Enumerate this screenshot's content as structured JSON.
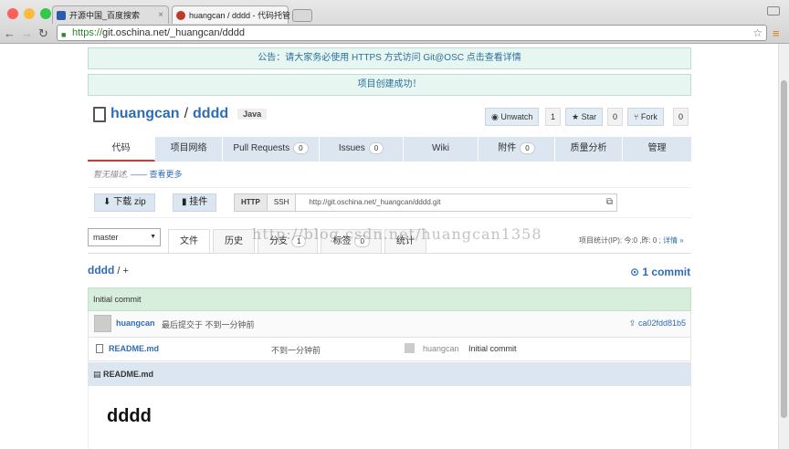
{
  "browser": {
    "tabs": [
      {
        "title": "开源中国_百度搜索",
        "close": "×"
      },
      {
        "title": "huangcan / dddd - 代码托管",
        "close": "×"
      }
    ],
    "url_scheme": "https://",
    "url_rest": "git.oschina.net/_huangcan/dddd",
    "nav": {
      "back": "←",
      "forward": "→",
      "reload": "↻"
    },
    "star": "☆",
    "menu": "≡"
  },
  "notices": {
    "announcement": "公告：请大家务必使用 HTTPS 方式访问 Git@OSC 点击查看详情",
    "created": "项目创建成功！"
  },
  "repo": {
    "owner": "huangcan",
    "separator": "/",
    "name": "dddd",
    "language": "Java",
    "watch_label": "◉ Unwatch",
    "watch_count": "1",
    "star_label": "★ Star",
    "star_count": "0",
    "fork_label": "⑂ Fork",
    "fork_count": "0"
  },
  "navbar": [
    {
      "label": "代码",
      "count": null
    },
    {
      "label": "项目网络",
      "count": null
    },
    {
      "label": "Pull Requests",
      "count": "0"
    },
    {
      "label": "Issues",
      "count": "0"
    },
    {
      "label": "Wiki",
      "count": null
    },
    {
      "label": "附件",
      "count": "0"
    },
    {
      "label": "质量分析",
      "count": null
    },
    {
      "label": "管理",
      "count": null
    }
  ],
  "description": {
    "empty": "暂无描述,",
    "more": "—— 查看更多"
  },
  "toolbar": {
    "download": "下载 zip",
    "plugin": "挂件",
    "http": "HTTP",
    "ssh": "SSH",
    "clone_url": "http://git.oschina.net/_huangcan/dddd.git",
    "copy": "⧉"
  },
  "branch": {
    "selected": "master",
    "caret": "▼"
  },
  "subtabs": [
    {
      "label": "文件",
      "count": null
    },
    {
      "label": "历史",
      "count": null
    },
    {
      "label": "分支",
      "count": "1"
    },
    {
      "label": "标签",
      "count": "0"
    },
    {
      "label": "统计",
      "count": null
    }
  ],
  "stats": {
    "text": "项目统计(IP): 今:0 ,昨: 0 ; ",
    "link": "详情 »"
  },
  "watermark": "http://blog.csdn.net/huangcan1358",
  "path": {
    "repo": "dddd",
    "add": " / +"
  },
  "commits_link": "⊙ 1 commit",
  "last_commit": {
    "message": "Initial commit",
    "author": "huangcan",
    "when": "最后提交于 不到一分钟前",
    "sha": "⇪ ca02fdd81b5"
  },
  "files": [
    {
      "name": "README.md",
      "time": "不到一分钟前",
      "author": "huangcan",
      "message": "Initial commit"
    }
  ],
  "readme": {
    "header": "README.md",
    "title": "dddd"
  }
}
